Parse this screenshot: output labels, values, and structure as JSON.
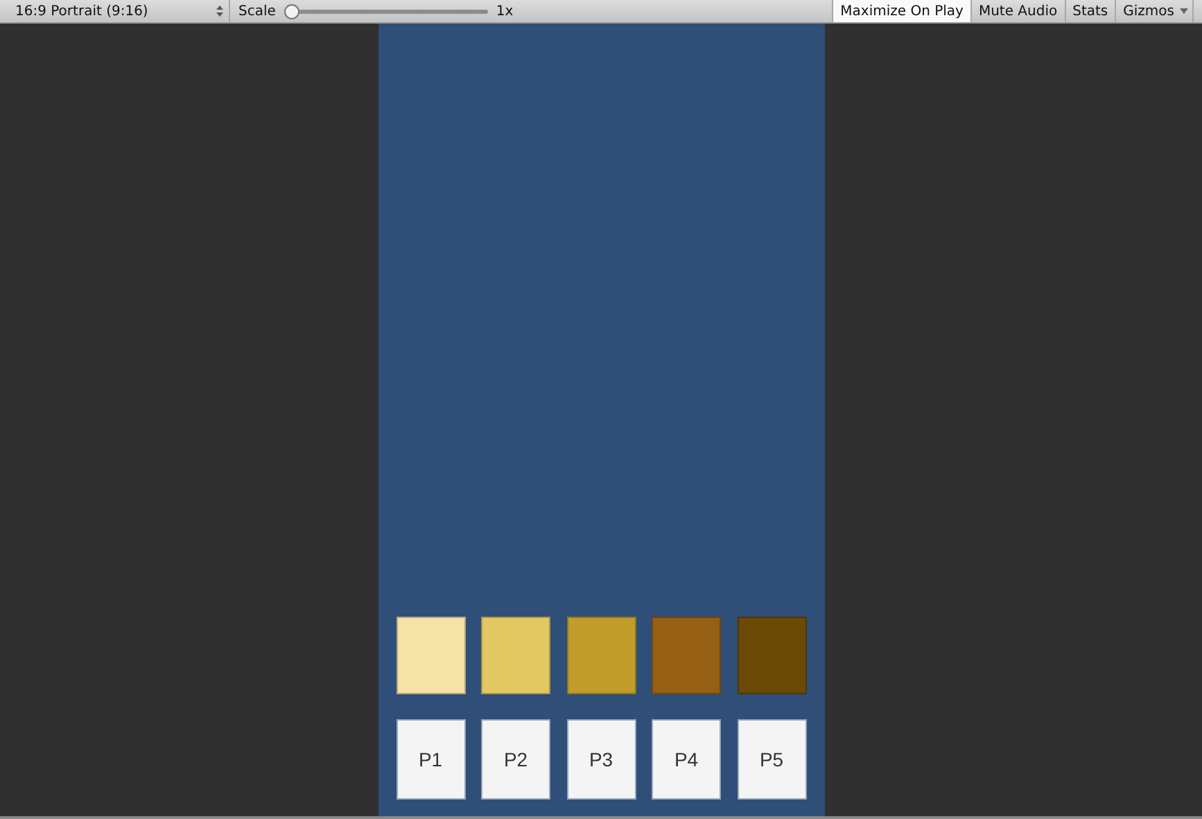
{
  "toolbar": {
    "aspect": {
      "value": "16:9 Portrait (9:16)"
    },
    "scale": {
      "label": "Scale",
      "level": 0,
      "reading": "1x"
    },
    "toggles": [
      {
        "label": "Maximize On Play",
        "selected": true
      },
      {
        "label": "Mute Audio",
        "selected": false
      },
      {
        "label": "Stats",
        "selected": false
      }
    ],
    "gizmos": {
      "label": "Gizmos"
    }
  },
  "swatches": [
    {
      "color": "#f5e2a6"
    },
    {
      "color": "#e3c762"
    },
    {
      "color": "#c29d2c"
    },
    {
      "color": "#956014"
    },
    {
      "color": "#6b4a05"
    }
  ],
  "buttons": [
    {
      "label": "P1"
    },
    {
      "label": "P2"
    },
    {
      "label": "P3"
    },
    {
      "label": "P4"
    },
    {
      "label": "P5"
    }
  ]
}
